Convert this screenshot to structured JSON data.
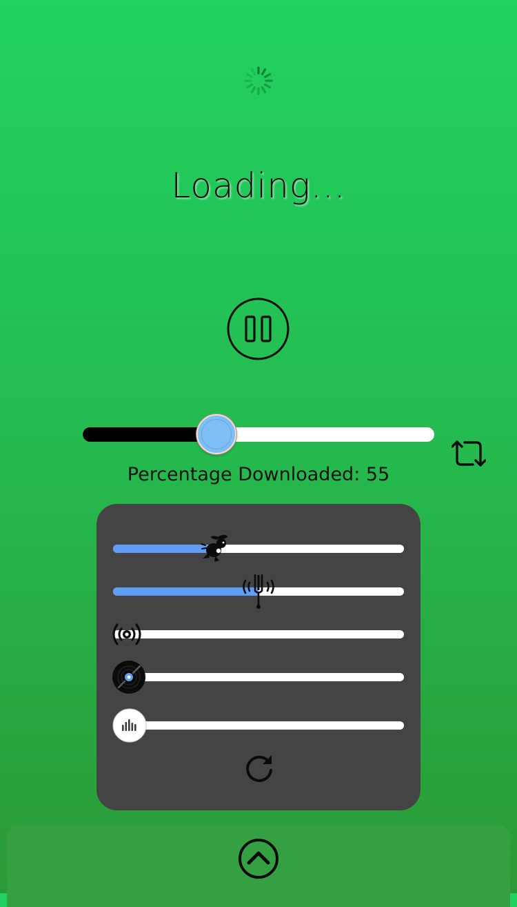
{
  "status": {
    "title": "Loading..."
  },
  "playback": {
    "state": "playing",
    "progress_fraction": 0.38
  },
  "download": {
    "label": "Percentage Downloaded: 55",
    "percent": 55
  },
  "effects": {
    "sliders": [
      {
        "name": "speed",
        "icon": "rabbit-icon",
        "value_fraction": 0.35
      },
      {
        "name": "pitch",
        "icon": "tuning-fork-icon",
        "value_fraction": 0.5
      },
      {
        "name": "reverb",
        "icon": "broadcast-icon",
        "value_fraction": 0.0
      },
      {
        "name": "vinyl",
        "icon": "vinyl-record-icon",
        "value_fraction": 0.0
      },
      {
        "name": "equalizer",
        "icon": "equalizer-icon",
        "value_fraction": 0.0
      }
    ]
  },
  "colors": {
    "background_top": "#21d161",
    "background_bottom": "#2c9a36",
    "panel": "#444444",
    "effect_fill": "#5f9ef5",
    "thumb": "#7dbff5"
  },
  "icons": {
    "spinner": "spinner-icon",
    "pause": "pause-circle-icon",
    "repeat": "repeat-icon",
    "reset": "refresh-icon",
    "expand": "chevron-up-circle-icon"
  }
}
